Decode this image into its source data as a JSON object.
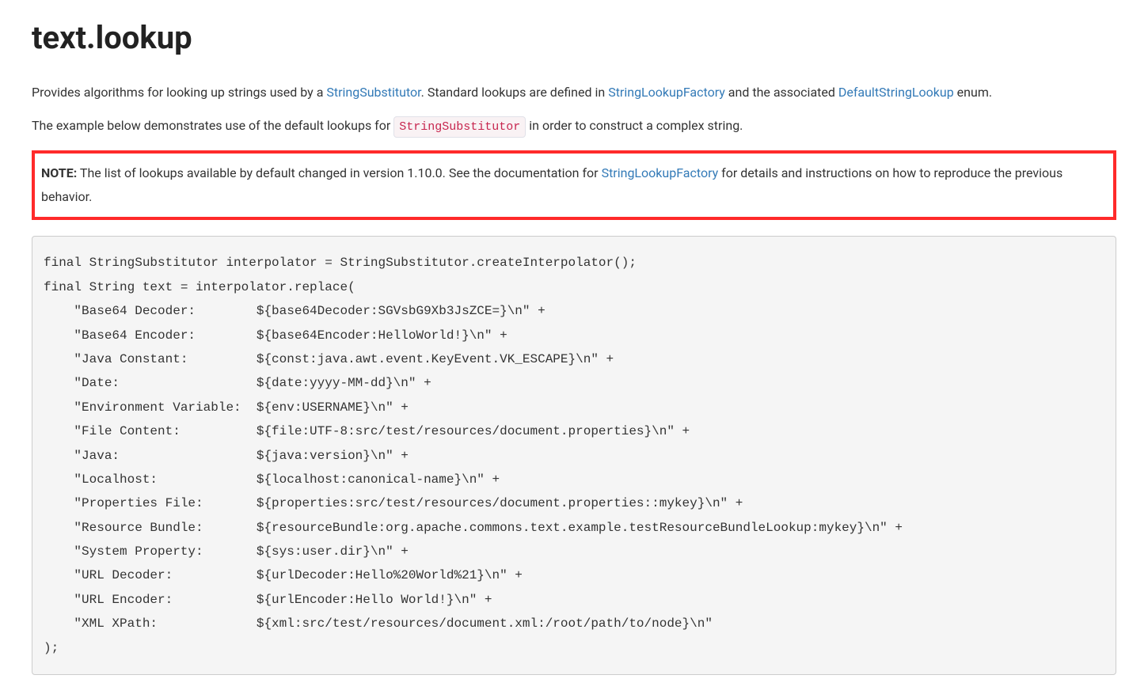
{
  "header": {
    "title": "text.lookup"
  },
  "para1": {
    "t1": "Provides algorithms for looking up strings used by a ",
    "link1": "StringSubstitutor",
    "t2": ". Standard lookups are defined in ",
    "link2": "StringLookupFactory",
    "t3": " and the associated ",
    "link3": "DefaultStringLookup",
    "t4": " enum."
  },
  "para2": {
    "t1": "The example below demonstrates use of the default lookups for ",
    "code1": "StringSubstitutor",
    "t2": " in order to construct a complex string."
  },
  "note": {
    "label": "NOTE:",
    "t1": " The list of lookups available by default changed in version 1.10.0. See the documentation for ",
    "link1": "StringLookupFactory",
    "t2": " for details and instructions on how to reproduce the previous behavior."
  },
  "code": "final StringSubstitutor interpolator = StringSubstitutor.createInterpolator();\nfinal String text = interpolator.replace(\n    \"Base64 Decoder:        ${base64Decoder:SGVsbG9Xb3JsZCE=}\\n\" +\n    \"Base64 Encoder:        ${base64Encoder:HelloWorld!}\\n\" +\n    \"Java Constant:         ${const:java.awt.event.KeyEvent.VK_ESCAPE}\\n\" +\n    \"Date:                  ${date:yyyy-MM-dd}\\n\" +\n    \"Environment Variable:  ${env:USERNAME}\\n\" +\n    \"File Content:          ${file:UTF-8:src/test/resources/document.properties}\\n\" +\n    \"Java:                  ${java:version}\\n\" +\n    \"Localhost:             ${localhost:canonical-name}\\n\" +\n    \"Properties File:       ${properties:src/test/resources/document.properties::mykey}\\n\" +\n    \"Resource Bundle:       ${resourceBundle:org.apache.commons.text.example.testResourceBundleLookup:mykey}\\n\" +\n    \"System Property:       ${sys:user.dir}\\n\" +\n    \"URL Decoder:           ${urlDecoder:Hello%20World%21}\\n\" +\n    \"URL Encoder:           ${urlEncoder:Hello World!}\\n\" +\n    \"XML XPath:             ${xml:src/test/resources/document.xml:/root/path/to/node}\\n\"\n);"
}
